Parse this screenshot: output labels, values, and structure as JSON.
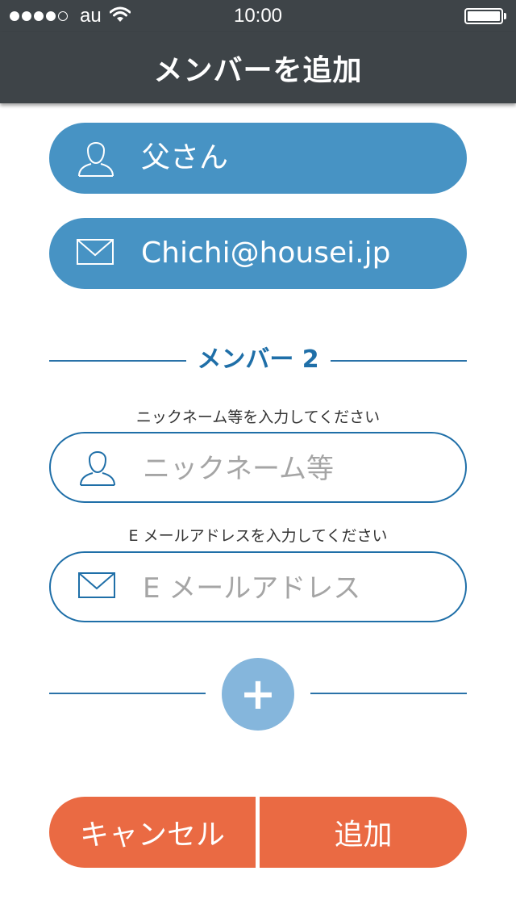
{
  "status_bar": {
    "carrier": "au",
    "time": "10:00",
    "signal_strength": 4,
    "signal_max": 5
  },
  "header": {
    "title": "メンバーを追加"
  },
  "member1": {
    "name": "父さん",
    "email": "Chichi@housei.jp"
  },
  "member2": {
    "section_title": "メンバー 2",
    "nickname_hint": "ニックネーム等を入力してください",
    "nickname_placeholder": "ニックネーム等",
    "email_hint": "E メールアドレスを入力してください",
    "email_placeholder": "E メールアドレス"
  },
  "add_member_icon": "+",
  "buttons": {
    "cancel": "キャンセル",
    "add": "追加"
  },
  "colors": {
    "header_bg": "#3e4448",
    "filled_pill": "#4793c4",
    "outline_border": "#1f6fa8",
    "add_circle": "#85b6dc",
    "action_button": "#ea6a43"
  }
}
